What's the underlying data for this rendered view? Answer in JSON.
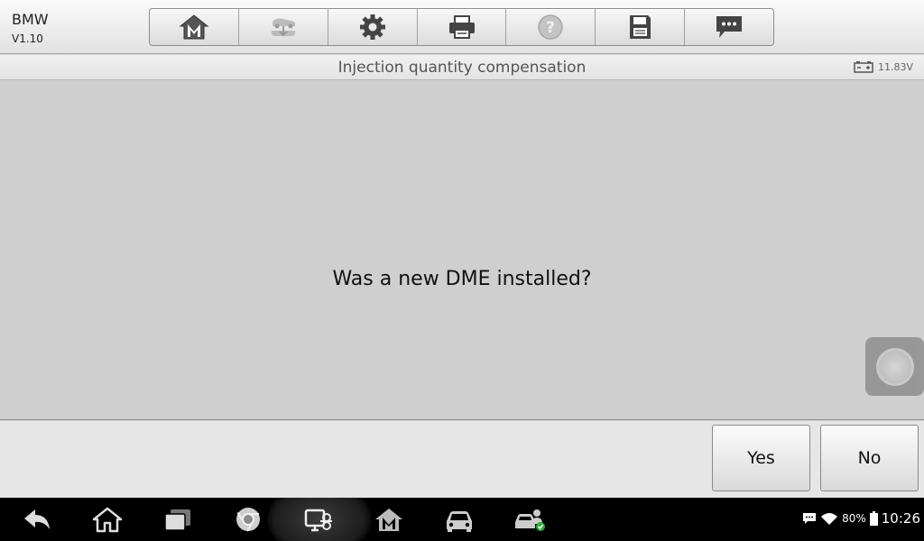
{
  "app": {
    "name": "BMW",
    "version": "V1.10"
  },
  "toolbar": {
    "items": [
      {
        "id": "home",
        "icon": "home-m-icon"
      },
      {
        "id": "vehicle-swap",
        "icon": "vehicle-swap-icon"
      },
      {
        "id": "settings",
        "icon": "gear-icon"
      },
      {
        "id": "print",
        "icon": "printer-icon"
      },
      {
        "id": "help",
        "icon": "help-icon"
      },
      {
        "id": "save",
        "icon": "floppy-icon"
      },
      {
        "id": "message",
        "icon": "chat-icon"
      }
    ]
  },
  "titlebar": {
    "title": "Injection quantity compensation",
    "voltage": "11.83V"
  },
  "dialog": {
    "question": "Was a new DME installed?"
  },
  "actions": {
    "yes_label": "Yes",
    "no_label": "No"
  },
  "status_bar": {
    "battery_pct": "80%",
    "time": "10:26"
  },
  "colors": {
    "content_bg": "#cfcfcf",
    "nav_bg": "#000000",
    "accent_green": "#2eaa3a"
  }
}
